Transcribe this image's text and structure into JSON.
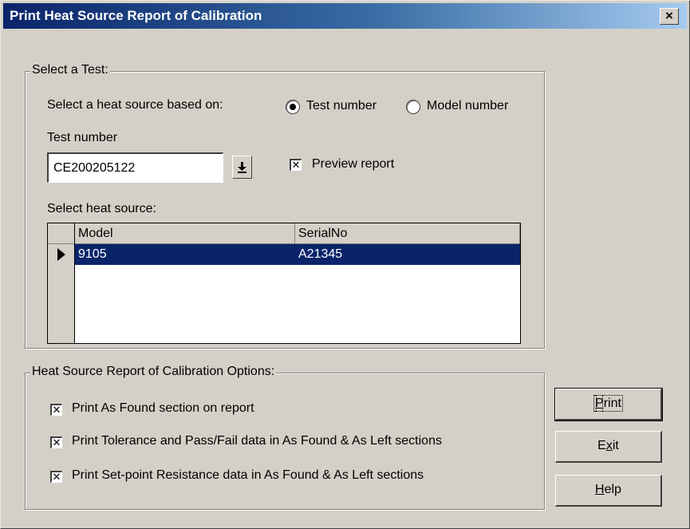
{
  "window": {
    "title": "Print Heat Source Report of Calibration",
    "close_label": "×"
  },
  "select_test": {
    "group_label": "Select a Test:",
    "based_on_label": "Select a heat source based on:",
    "radio_test_number": "Test number",
    "radio_model_number": "Model number",
    "selected_radio": "Test number",
    "test_number_label": "Test number",
    "test_number_value": "CE200205122",
    "preview_label": "Preview report",
    "preview_checked": true,
    "heat_source_label": "Select heat source:",
    "grid": {
      "columns": [
        "Model",
        "SerialNo"
      ],
      "rows": [
        {
          "model": "9105",
          "serial": "A21345",
          "selected": true
        }
      ]
    }
  },
  "options": {
    "group_label": "Heat Source Report of Calibration Options:",
    "items": [
      {
        "label": "Print As Found section on report",
        "checked": true
      },
      {
        "label": "Print Tolerance and Pass/Fail data in As Found & As Left sections",
        "checked": true
      },
      {
        "label": "Print Set-point Resistance data in As Found & As Left sections",
        "checked": true
      }
    ]
  },
  "buttons": {
    "print": {
      "before": "",
      "mnemonic": "P",
      "after": "rint"
    },
    "exit": {
      "before": "E",
      "mnemonic": "x",
      "after": "it"
    },
    "help": {
      "before": "",
      "mnemonic": "H",
      "after": "elp"
    }
  },
  "colors": {
    "title_start": "#0a246a",
    "title_end": "#a6caf0",
    "face": "#d4d0c8",
    "selection": "#0a246a"
  }
}
